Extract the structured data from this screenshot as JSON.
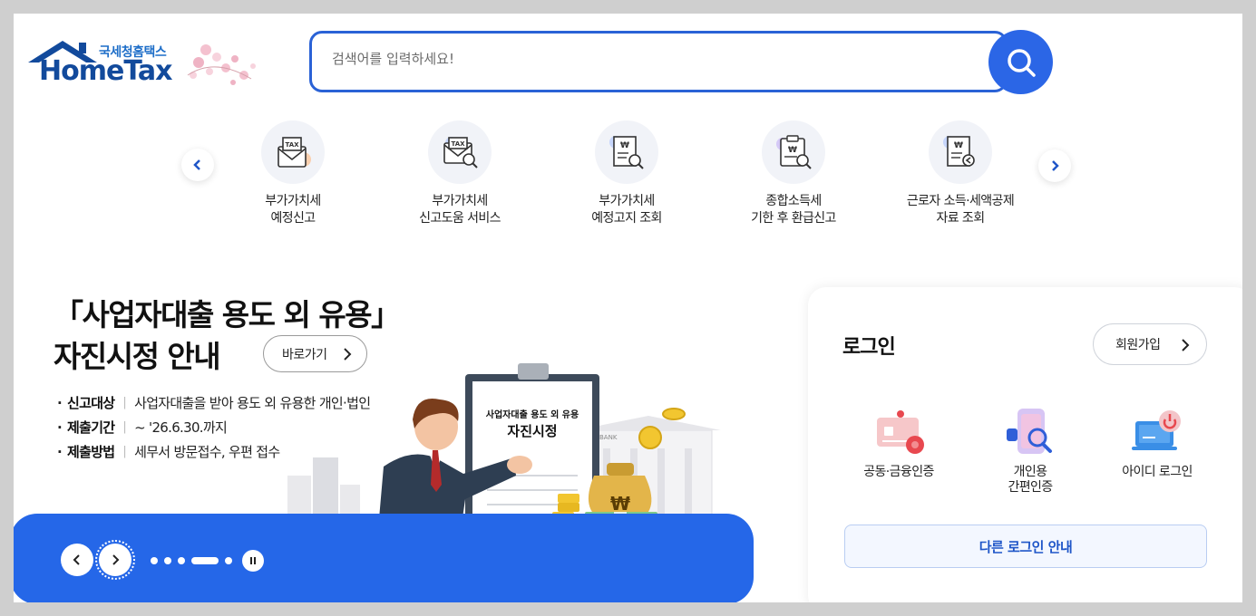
{
  "header": {
    "logo_sub": "국세청홈택스",
    "logo_main": "HomeTax",
    "search_placeholder": "검색어를 입력하세요!"
  },
  "quick_menu": {
    "items": [
      {
        "label": "부가가치세\n예정신고",
        "icon": "tax-envelope-icon"
      },
      {
        "label": "부가가치세\n신고도움 서비스",
        "icon": "tax-search-icon"
      },
      {
        "label": "부가가치세\n예정고지 조회",
        "icon": "receipt-search-icon"
      },
      {
        "label": "종합소득세\n기한 후 환급신고",
        "icon": "clipboard-search-icon"
      },
      {
        "label": "근로자 소득·세액공제\n자료 조회",
        "icon": "receipt-arrow-icon"
      }
    ]
  },
  "banner": {
    "title": "「사업자대출 용도 외 유용」\n 자진시정 안내",
    "goto_label": "바로가기",
    "info": [
      {
        "key": "신고대상",
        "value": "사업자대출을 받아 용도 외 유용한 개인·법인"
      },
      {
        "key": "제출기간",
        "value": "~ '26.6.30.까지"
      },
      {
        "key": "제출방법",
        "value": "세무서 방문접수, 우편 접수"
      }
    ],
    "clipboard_line1": "사업자대출 용도 외 유용",
    "clipboard_line2": "자진시정",
    "bank_label": "BANK",
    "money_symbol": "₩"
  },
  "login": {
    "title": "로그인",
    "join_label": "회원가입",
    "options": [
      {
        "label": "공동·금융인증",
        "icon": "certificate-card-icon"
      },
      {
        "label": "개인용\n간편인증",
        "icon": "simple-auth-phone-icon"
      },
      {
        "label": "아이디 로그인",
        "icon": "id-login-laptop-icon"
      }
    ],
    "other_label": "다른 로그인 안내"
  },
  "colors": {
    "primary": "#2567e8",
    "logo_navy": "#124a9c",
    "text": "#111111"
  }
}
